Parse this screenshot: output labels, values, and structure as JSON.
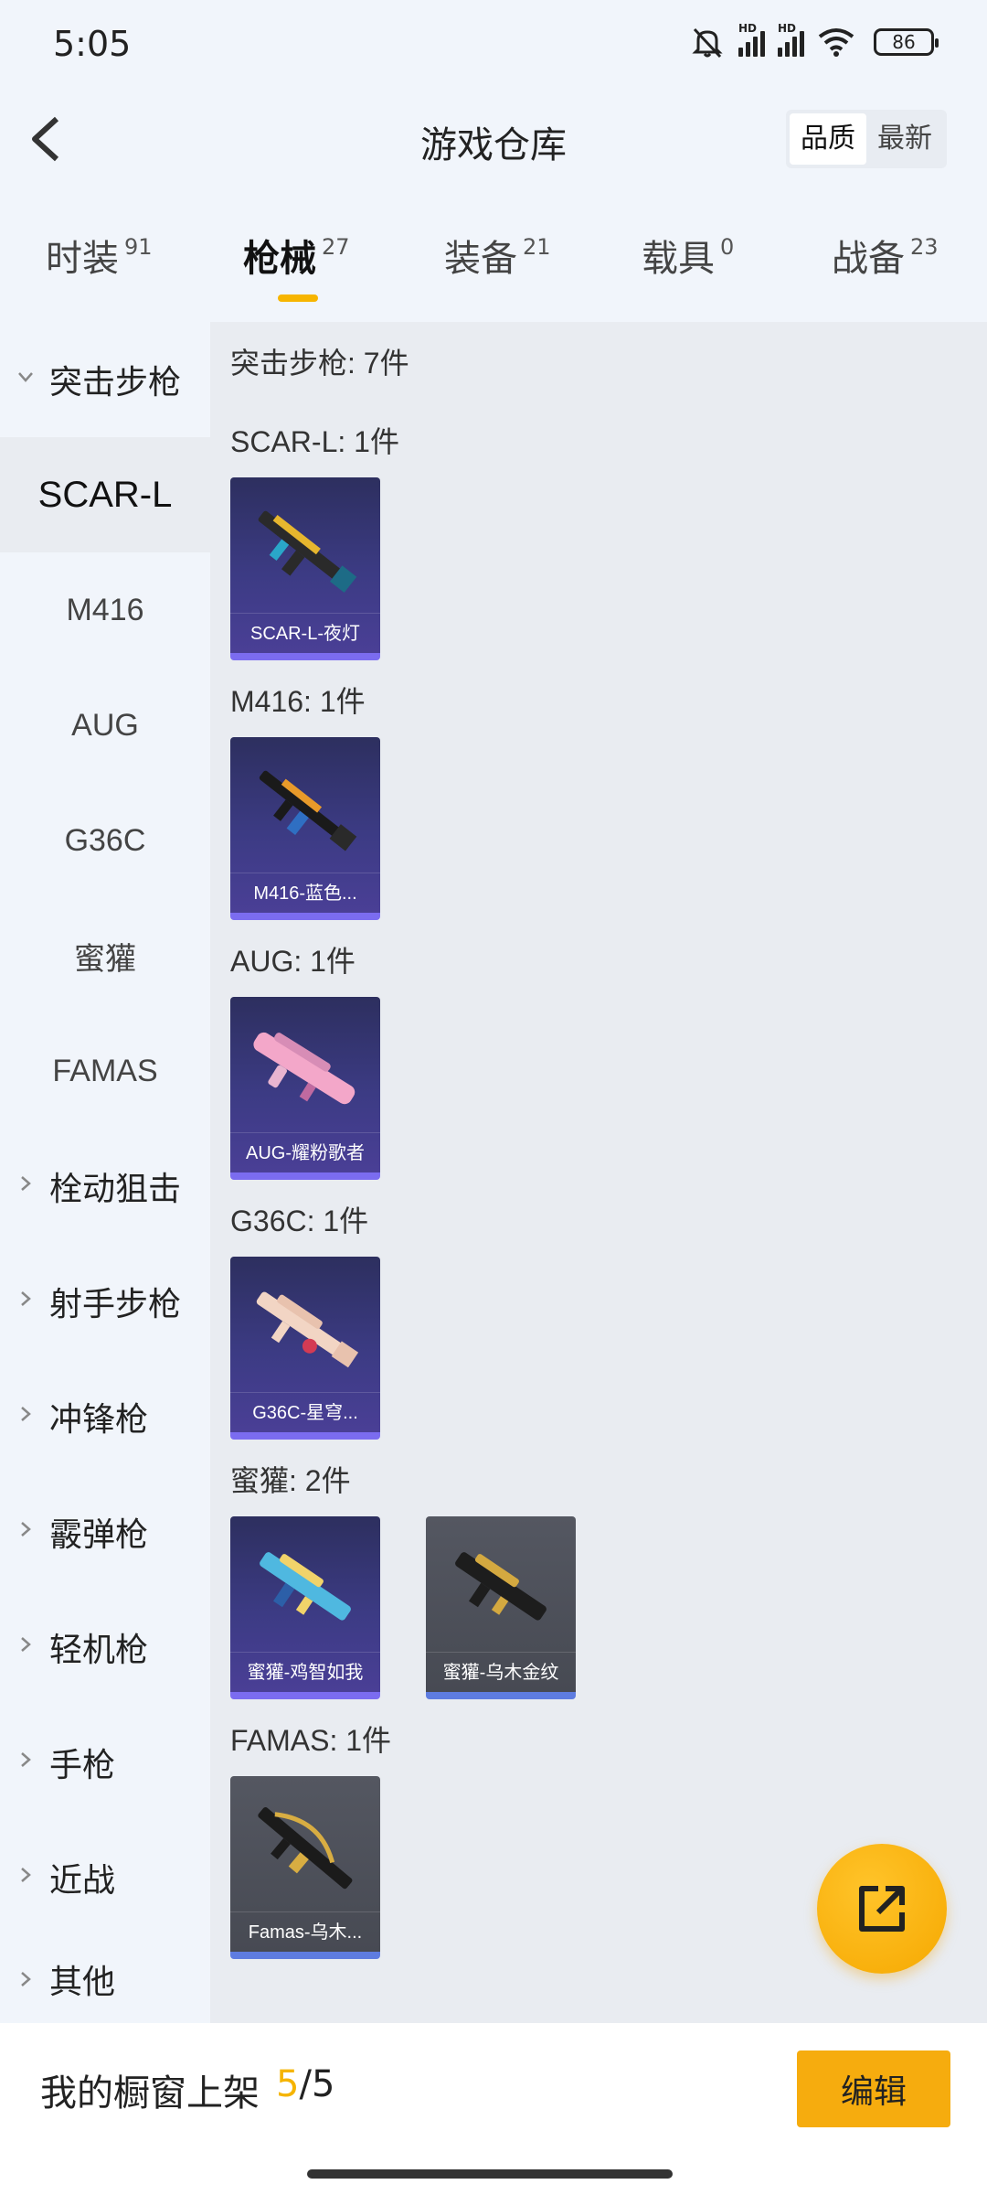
{
  "status_bar": {
    "time": "5:05",
    "battery": "86",
    "hd1": "HD",
    "hd2": "HD"
  },
  "header": {
    "title": "游戏仓库",
    "sort": [
      "品质",
      "最新"
    ]
  },
  "tabs": [
    {
      "label": "时装",
      "count": "91"
    },
    {
      "label": "枪械",
      "count": "27"
    },
    {
      "label": "装备",
      "count": "21"
    },
    {
      "label": "载具",
      "count": "0"
    },
    {
      "label": "战备",
      "count": "23"
    }
  ],
  "sidebar": {
    "expanded_category": "突击步枪",
    "subitems": [
      "SCAR-L",
      "M416",
      "AUG",
      "G36C",
      "蜜獾",
      "FAMAS"
    ],
    "categories": [
      "栓动狙击",
      "射手步枪",
      "冲锋枪",
      "霰弹枪",
      "轻机枪",
      "手枪",
      "近战",
      "其他"
    ]
  },
  "content": {
    "total_label": "突击步枪: 7件",
    "groups": [
      {
        "label": "SCAR-L: 1件",
        "items": [
          "SCAR-L-夜灯"
        ]
      },
      {
        "label": "M416: 1件",
        "items": [
          "M416-蓝色..."
        ]
      },
      {
        "label": "AUG: 1件",
        "items": [
          "AUG-耀粉歌者"
        ]
      },
      {
        "label": "G36C: 1件",
        "items": [
          "G36C-星穹..."
        ]
      },
      {
        "label": "蜜獾: 2件",
        "items": [
          "蜜獾-鸡智如我",
          "蜜獾-乌木金纹"
        ]
      },
      {
        "label": "FAMAS: 1件",
        "items": [
          "Famas-乌木..."
        ]
      }
    ]
  },
  "bottom_bar": {
    "label": "我的橱窗上架",
    "current": "5",
    "separator": "/",
    "total": "5",
    "edit_label": "编辑"
  },
  "colors": {
    "accent": "#f6ac0e",
    "card_purple": "#3c3b84",
    "card_gray": "#4d5059"
  }
}
